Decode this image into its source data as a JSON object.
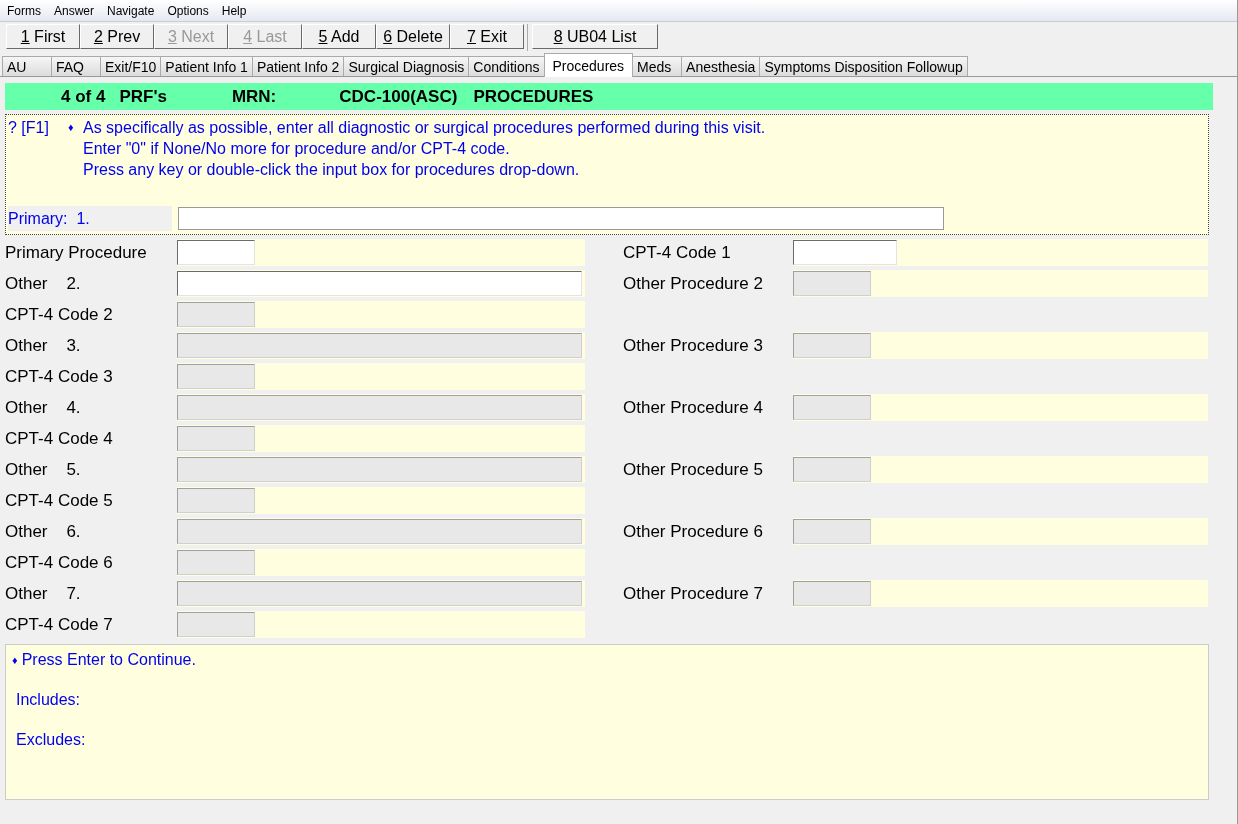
{
  "menu": [
    "Forms",
    "Answer",
    "Navigate",
    "Options",
    "Help"
  ],
  "toolbar": [
    {
      "key": "1",
      "label": "First",
      "disabled": false
    },
    {
      "key": "2",
      "label": "Prev",
      "disabled": false
    },
    {
      "key": "3",
      "label": "Next",
      "disabled": true
    },
    {
      "key": "4",
      "label": "Last",
      "disabled": true
    },
    {
      "key": "5",
      "label": "Add",
      "disabled": false
    },
    {
      "key": "6",
      "label": "Delete",
      "disabled": false
    },
    {
      "key": "7",
      "label": "Exit",
      "disabled": false
    },
    {
      "key": "8",
      "label": "UB04 List",
      "disabled": false
    }
  ],
  "tabs": [
    {
      "label": "AU",
      "selected": false
    },
    {
      "label": "FAQ",
      "selected": false
    },
    {
      "label": "Exit/F10",
      "selected": false
    },
    {
      "label": "Patient Info 1",
      "selected": false
    },
    {
      "label": "Patient Info 2",
      "selected": false
    },
    {
      "label": "Surgical Diagnosis",
      "selected": false
    },
    {
      "label": "Conditions",
      "selected": false
    },
    {
      "label": "Procedures",
      "selected": true
    },
    {
      "label": "Meds",
      "selected": false
    },
    {
      "label": "Anesthesia",
      "selected": false
    },
    {
      "label": "Symptoms Disposition Followup",
      "selected": false
    }
  ],
  "header": {
    "record": "4 of 4",
    "record_type": "PRF's",
    "mrn_label": "MRN:",
    "form_code": "CDC-100(ASC)",
    "section": "PROCEDURES"
  },
  "help": {
    "marker": "? [F1]",
    "bullet": "♦",
    "lines": [
      "As specifically as possible, enter all diagnostic or surgical procedures performed during this visit.",
      "Enter \"0\" if None/No more for procedure and/or CPT-4 code.",
      "Press any key or double-click the input box for procedures drop-down."
    ],
    "prompt_label": "Primary:  1."
  },
  "rows": [
    {
      "left": {
        "label": "Primary Procedure",
        "kind": "short",
        "disabled": false
      },
      "right": {
        "label": "CPT-4 Code 1",
        "kind": "code",
        "disabled": false
      }
    },
    {
      "left": {
        "label": "Other    2.",
        "kind": "wide",
        "disabled": false
      },
      "right": {
        "label": "Other Procedure 2",
        "kind": "short",
        "disabled": true
      }
    },
    {
      "left": {
        "label": "CPT-4 Code 2",
        "kind": "short",
        "disabled": true
      }
    },
    {
      "left": {
        "label": "Other    3.",
        "kind": "wide",
        "disabled": true
      },
      "right": {
        "label": "Other Procedure 3",
        "kind": "short",
        "disabled": true
      }
    },
    {
      "left": {
        "label": "CPT-4 Code 3",
        "kind": "short",
        "disabled": true
      }
    },
    {
      "left": {
        "label": "Other    4.",
        "kind": "wide",
        "disabled": true
      },
      "right": {
        "label": "Other Procedure 4",
        "kind": "short",
        "disabled": true
      }
    },
    {
      "left": {
        "label": "CPT-4 Code 4",
        "kind": "short",
        "disabled": true
      }
    },
    {
      "left": {
        "label": "Other    5.",
        "kind": "wide",
        "disabled": true
      },
      "right": {
        "label": "Other Procedure 5",
        "kind": "short",
        "disabled": true
      }
    },
    {
      "left": {
        "label": "CPT-4 Code 5",
        "kind": "short",
        "disabled": true
      }
    },
    {
      "left": {
        "label": "Other    6.",
        "kind": "wide",
        "disabled": true
      },
      "right": {
        "label": "Other Procedure 6",
        "kind": "short",
        "disabled": true
      }
    },
    {
      "left": {
        "label": "CPT-4 Code 6",
        "kind": "short",
        "disabled": true
      }
    },
    {
      "left": {
        "label": "Other    7.",
        "kind": "wide",
        "disabled": true
      },
      "right": {
        "label": "Other Procedure 7",
        "kind": "short",
        "disabled": true
      }
    },
    {
      "left": {
        "label": "CPT-4 Code 7",
        "kind": "short",
        "disabled": true
      }
    }
  ],
  "footer": {
    "bullet": "♦",
    "instruction": "Press Enter to Continue.",
    "includes_label": "Includes:",
    "excludes_label": "Excludes:"
  }
}
